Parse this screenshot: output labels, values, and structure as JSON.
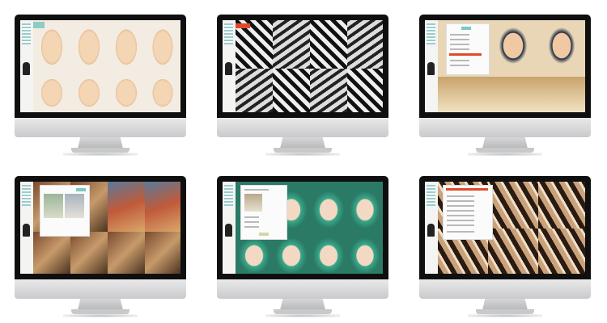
{
  "image": {
    "description_kind": "showcase of six desktop monitors displaying a photographer portfolio website",
    "monitor_count": 6,
    "brand_logo_icon": "apple-logo-icon"
  },
  "colors": {
    "bezel": "#0f0f10",
    "chin": "#d9d9db",
    "accent_teal": "#7cc9c0",
    "accent_red": "#e04a2a"
  }
}
